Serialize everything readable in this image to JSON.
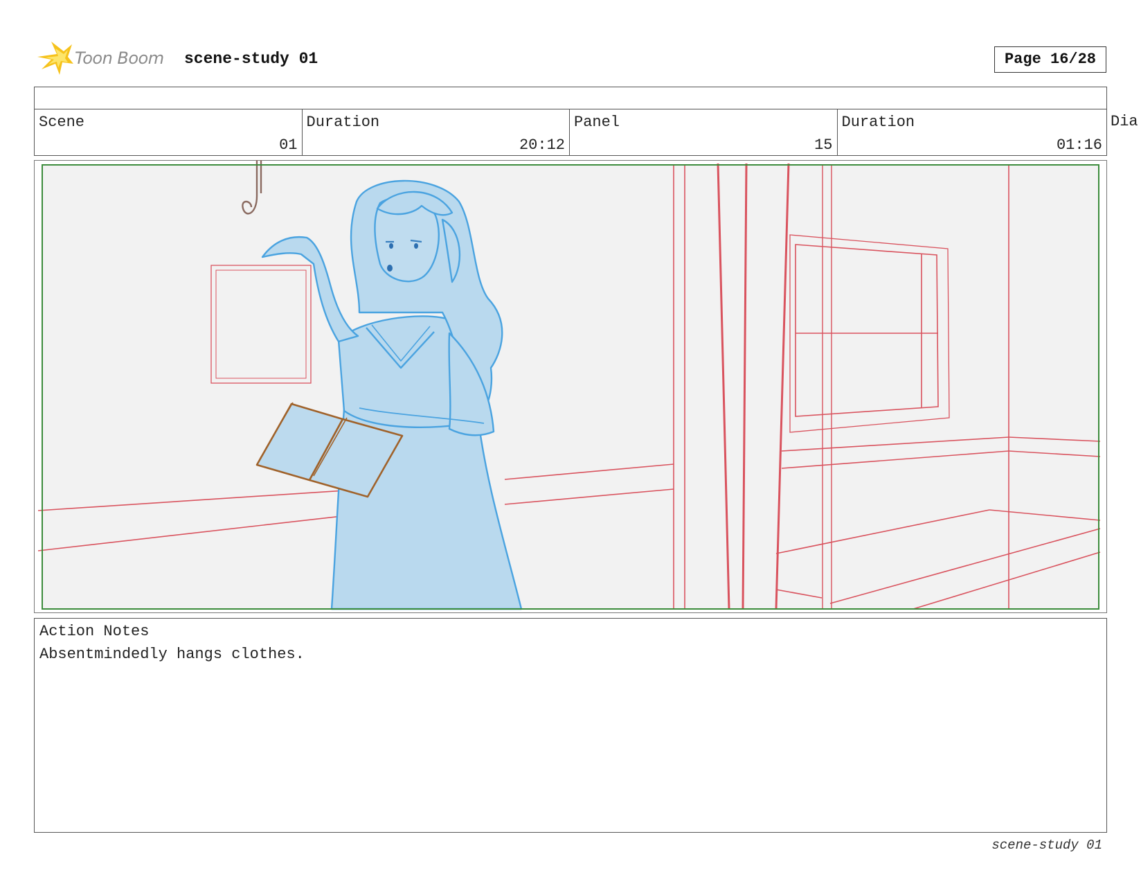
{
  "header": {
    "logo_text": "Toon Boom",
    "title": "scene-study 01",
    "page": "Page 16/28"
  },
  "meta": [
    {
      "label": "Scene",
      "value": "01"
    },
    {
      "label": "Duration",
      "value": "20:12"
    },
    {
      "label": "Panel",
      "value": "15"
    },
    {
      "label": "Duration",
      "value": "01:16"
    }
  ],
  "meta_overflow": "Dia",
  "notes": {
    "label": "Action Notes",
    "text": "Absentmindedly hangs clothes."
  },
  "footer": "scene-study 01",
  "colors": {
    "frame_green": "#3c8c3c",
    "layout_red": "#d9535e",
    "character_blue": "#b9d9ee",
    "character_line": "#4aa3e0",
    "prop_brown": "#a0622a"
  }
}
